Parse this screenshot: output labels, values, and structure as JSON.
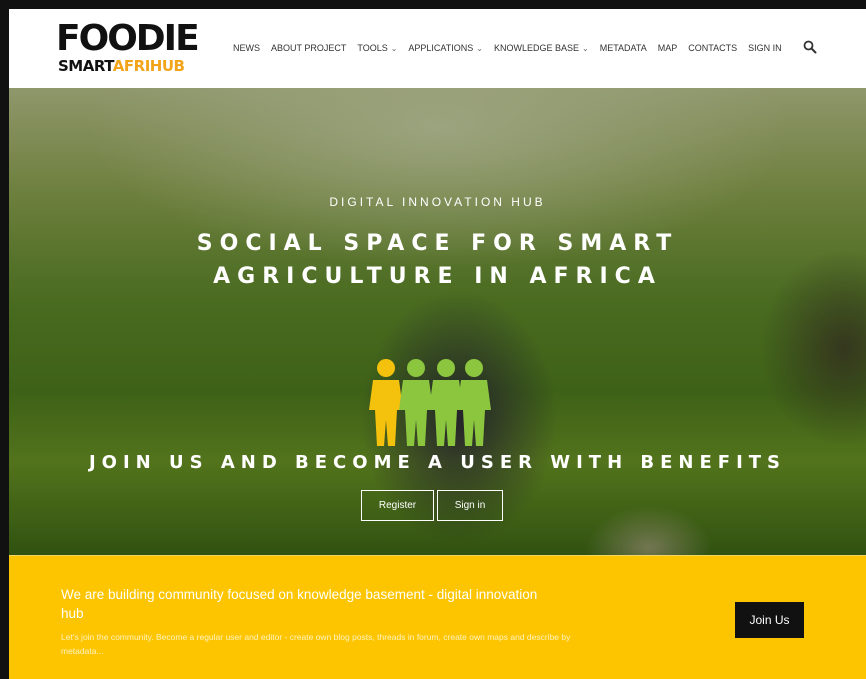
{
  "brand": {
    "top": "FOODIE",
    "bottom_a": "SMART",
    "bottom_b": "AFRIHUB"
  },
  "nav": {
    "items": [
      {
        "label": "NEWS",
        "dropdown": false
      },
      {
        "label": "ABOUT PROJECT",
        "dropdown": false
      },
      {
        "label": "TOOLS",
        "dropdown": true
      },
      {
        "label": "APPLICATIONS",
        "dropdown": true
      },
      {
        "label": "KNOWLEDGE BASE",
        "dropdown": true
      },
      {
        "label": "METADATA",
        "dropdown": false
      },
      {
        "label": "MAP",
        "dropdown": false
      },
      {
        "label": "CONTACTS",
        "dropdown": false
      },
      {
        "label": "SIGN IN",
        "dropdown": false
      }
    ],
    "search_icon": "search-icon"
  },
  "hero": {
    "kicker": "DIGITAL INNOVATION HUB",
    "title": "SOCIAL SPACE FOR SMART AGRICULTURE IN AFRICA",
    "join_heading": "JOIN US AND BECOME A USER WITH BENEFITS",
    "register_label": "Register",
    "signin_label": "Sign in"
  },
  "band": {
    "title": "We are building community focused on knowledge basement - digital innovation hub",
    "text": "Let's join the community. Become a regular user and editor - create own blog posts, threads in forum, create own maps and describe by metadata...",
    "join_label": "Join Us",
    "bg_color": "#fdc500"
  },
  "colors": {
    "accent_orange": "#f2a51a",
    "people_yellow": "#f4c20d",
    "people_green": "#8cc63f"
  }
}
